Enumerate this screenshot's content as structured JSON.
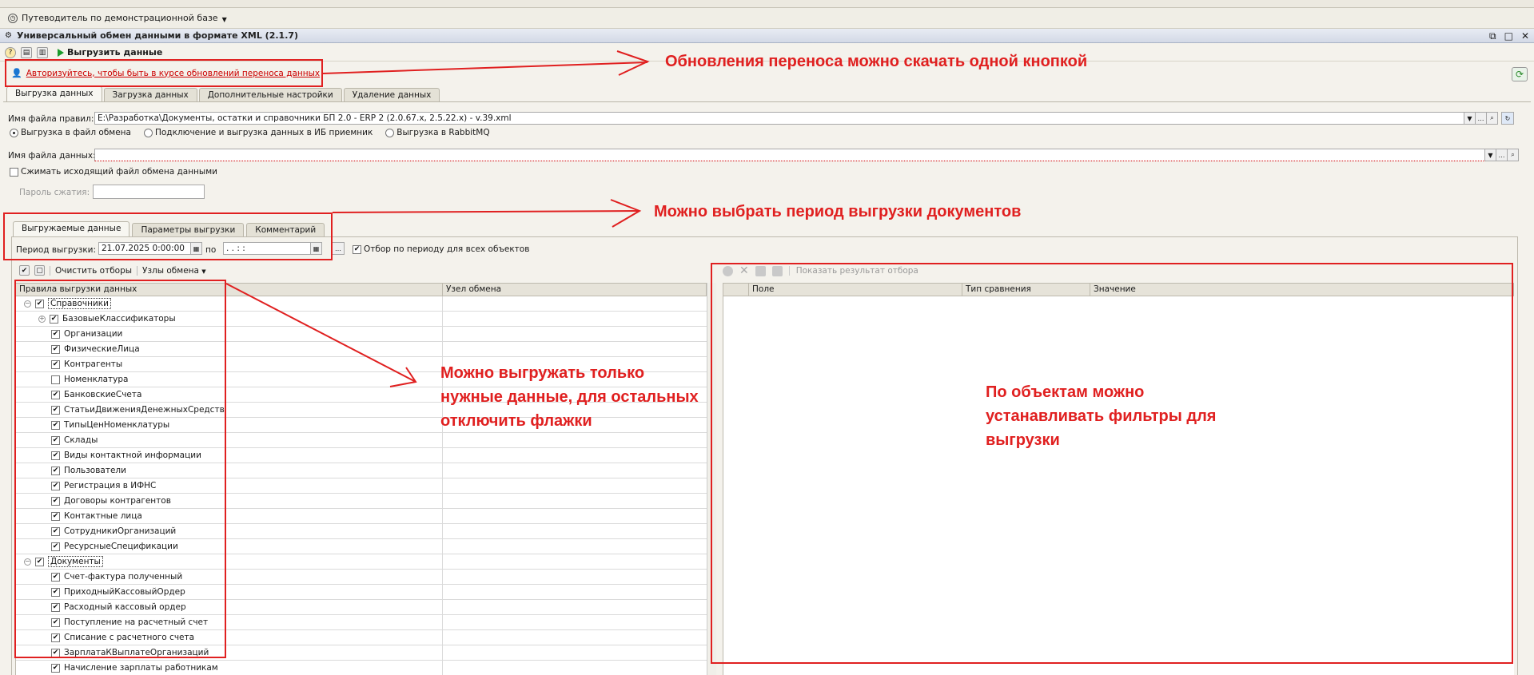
{
  "guide": {
    "label": "Путеводитель по демонстрационной базе"
  },
  "window": {
    "title": "Универсальный обмен данными в формате XML (2.1.7)",
    "controls": [
      "⧉",
      "□",
      "✕"
    ]
  },
  "toolbar": {
    "run_label": "Выгрузить данные"
  },
  "auth": {
    "link": "Авторизуйтесь, чтобы быть в курсе обновлений переноса данных"
  },
  "main_tabs": [
    "Выгрузка данных",
    "Загрузка данных",
    "Дополнительные настройки",
    "Удаление данных"
  ],
  "rules_file": {
    "label": "Имя файла правил:",
    "value": "E:\\Разработка\\Документы, остатки и справочники БП 2.0 - ERP 2 (2.0.67.x, 2.5.22.x) - v.39.xml"
  },
  "export_modes": [
    {
      "label": "Выгрузка в файл обмена",
      "selected": true
    },
    {
      "label": "Подключение и выгрузка данных в ИБ приемник",
      "selected": false
    },
    {
      "label": "Выгрузка в RabbitMQ",
      "selected": false
    }
  ],
  "data_file": {
    "label": "Имя файла данных:",
    "value": ""
  },
  "compress": {
    "label": "Сжимать исходящий файл обмена данными",
    "checked": false
  },
  "password": {
    "label": "Пароль сжатия:",
    "value": ""
  },
  "sub_tabs": [
    "Выгружаемые данные",
    "Параметры выгрузки",
    "Комментарий"
  ],
  "period": {
    "label": "Период выгрузки:",
    "from": "21.07.2025  0:00:00",
    "to_label": "по",
    "to": "  .  .       :  :",
    "filter_all_label": "Отбор по периоду для всех объектов",
    "filter_all_checked": true
  },
  "tree_toolbar": {
    "clear_label": "Очистить отборы",
    "nodes_label": "Узлы обмена"
  },
  "tree": {
    "col1": "Правила выгрузки данных",
    "col2": "Узел обмена",
    "rows": [
      {
        "name": "Справочники",
        "level": 0,
        "checked": true,
        "group": true
      },
      {
        "name": "БазовыеКлассификаторы",
        "level": 1,
        "checked": true,
        "expandable": true
      },
      {
        "name": "Организации",
        "level": 1,
        "checked": true
      },
      {
        "name": "ФизическиеЛица",
        "level": 1,
        "checked": true
      },
      {
        "name": "Контрагенты",
        "level": 1,
        "checked": true
      },
      {
        "name": "Номенклатура",
        "level": 1,
        "checked": false
      },
      {
        "name": "БанковскиеСчета",
        "level": 1,
        "checked": true
      },
      {
        "name": "СтатьиДвиженияДенежныхСредств",
        "level": 1,
        "checked": true
      },
      {
        "name": "ТипыЦенНоменклатуры",
        "level": 1,
        "checked": true
      },
      {
        "name": "Склады",
        "level": 1,
        "checked": true
      },
      {
        "name": "Виды контактной информации",
        "level": 1,
        "checked": true
      },
      {
        "name": "Пользователи",
        "level": 1,
        "checked": true
      },
      {
        "name": "Регистрация в ИФНС",
        "level": 1,
        "checked": true
      },
      {
        "name": "Договоры контрагентов",
        "level": 1,
        "checked": true
      },
      {
        "name": "Контактные лица",
        "level": 1,
        "checked": true
      },
      {
        "name": "СотрудникиОрганизаций",
        "level": 1,
        "checked": true
      },
      {
        "name": "РесурсныеСпецификации",
        "level": 1,
        "checked": true
      },
      {
        "name": "Документы",
        "level": 0,
        "checked": true,
        "group": true
      },
      {
        "name": "Счет-фактура полученный",
        "level": 1,
        "checked": true
      },
      {
        "name": "ПриходныйКассовыйОрдер",
        "level": 1,
        "checked": true
      },
      {
        "name": "Расходный кассовый ордер",
        "level": 1,
        "checked": true
      },
      {
        "name": "Поступление на расчетный счет",
        "level": 1,
        "checked": true
      },
      {
        "name": "Списание с расчетного счета",
        "level": 1,
        "checked": true
      },
      {
        "name": "ЗарплатаКВыплатеОрганизаций",
        "level": 1,
        "checked": true
      },
      {
        "name": "Начисление зарплаты работникам",
        "level": 1,
        "checked": true
      }
    ]
  },
  "filter_toolbar": {
    "show_result_label": "Показать результат отбора"
  },
  "filter_table": {
    "columns": [
      "Поле",
      "Тип сравнения",
      "Значение"
    ]
  },
  "annotations": {
    "a1": "Обновления переноса можно скачать одной кнопкой",
    "a2": "Можно выбрать период выгрузки документов",
    "a3": "Можно выгружать только нужные данные, для остальных отключить флажки",
    "a4": "По объектам можно устанавливать фильтры для выгрузки"
  },
  "annotation_color": "#e02020"
}
